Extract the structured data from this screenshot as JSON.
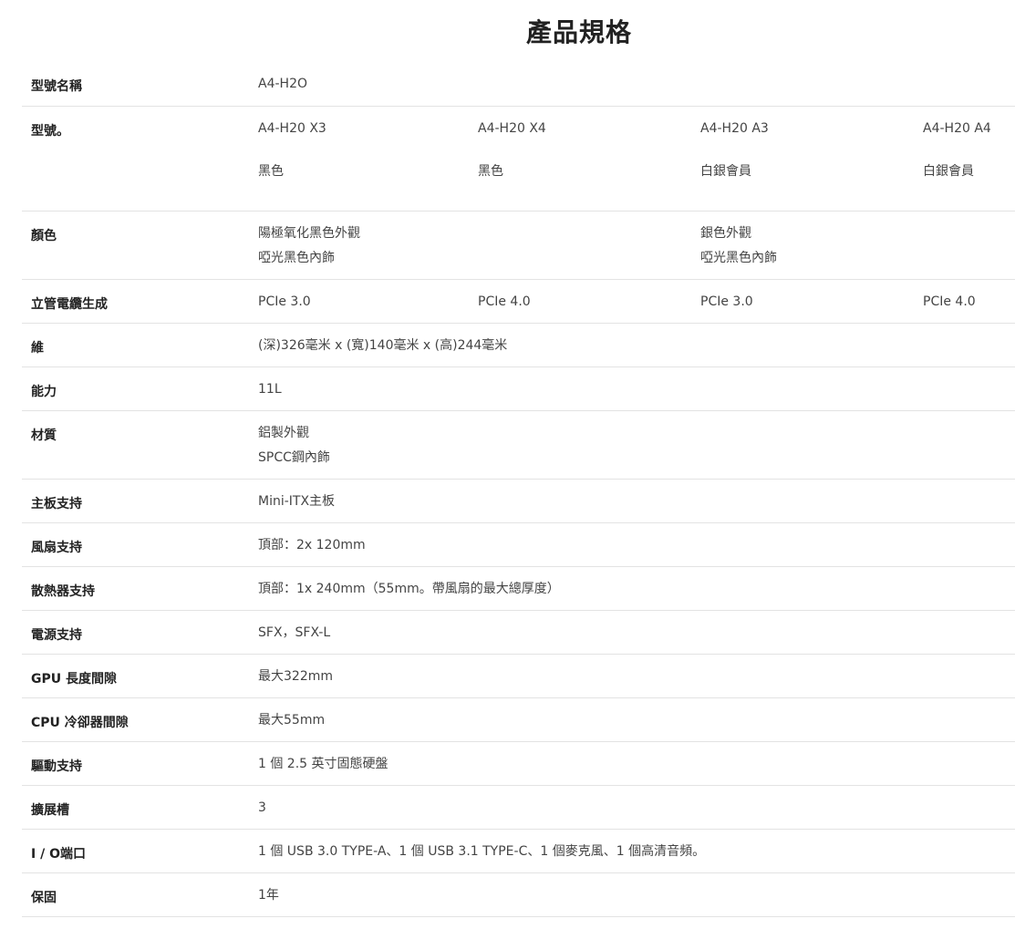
{
  "page_title": "產品規格",
  "rows": {
    "model_name": {
      "label": "型號名稱",
      "value": "A4-H2O"
    },
    "model": {
      "label": "型號。",
      "variants": [
        {
          "name": "A4-H20 X3",
          "color": "黑色"
        },
        {
          "name": "A4-H20 X4",
          "color": "黑色"
        },
        {
          "name": "A4-H20 A3",
          "color": "白銀會員"
        },
        {
          "name": "A4-H20 A4",
          "color": "白銀會員"
        }
      ]
    },
    "color": {
      "label": "顏色",
      "black": {
        "line1": "陽極氧化黑色外觀",
        "line2": "啞光黑色內飾"
      },
      "silver": {
        "line1": "銀色外觀",
        "line2": "啞光黑色內飾"
      }
    },
    "riser": {
      "label": "立管電纜生成",
      "values": [
        "PCIe 3.0",
        "PCIe 4.0",
        "PCIe 3.0",
        "PCIe 4.0"
      ]
    },
    "dimensions": {
      "label": "維",
      "value": "(深)326毫米 x (寬)140毫米 x (高)244毫米"
    },
    "capacity": {
      "label": "能力",
      "value": "11L"
    },
    "material": {
      "label": "材質",
      "line1": "鋁製外觀",
      "line2": "SPCC鋼內飾"
    },
    "motherboard": {
      "label": "主板支持",
      "value": "Mini-ITX主板"
    },
    "fan": {
      "label": "風扇支持",
      "value": "頂部：2x 120mm"
    },
    "radiator": {
      "label": "散熱器支持",
      "value": "頂部：1x 240mm（55mm。帶風扇的最大總厚度）"
    },
    "psu": {
      "label": "電源支持",
      "value": "SFX，SFX-L"
    },
    "gpu": {
      "label": "GPU 長度間隙",
      "value": "最大322mm"
    },
    "cpu": {
      "label": "CPU 冷卻器間隙",
      "value": "最大55mm"
    },
    "drive": {
      "label": "驅動支持",
      "value": "1 個 2.5 英寸固態硬盤"
    },
    "expansion": {
      "label": "擴展槽",
      "value": "3"
    },
    "io": {
      "label": "I / O端口",
      "value": "1 個 USB 3.0 TYPE-A、1 個 USB 3.1 TYPE-C、1 個麥克風、1 個高清音頻。"
    },
    "warranty": {
      "label": "保固",
      "value": "1年"
    }
  }
}
